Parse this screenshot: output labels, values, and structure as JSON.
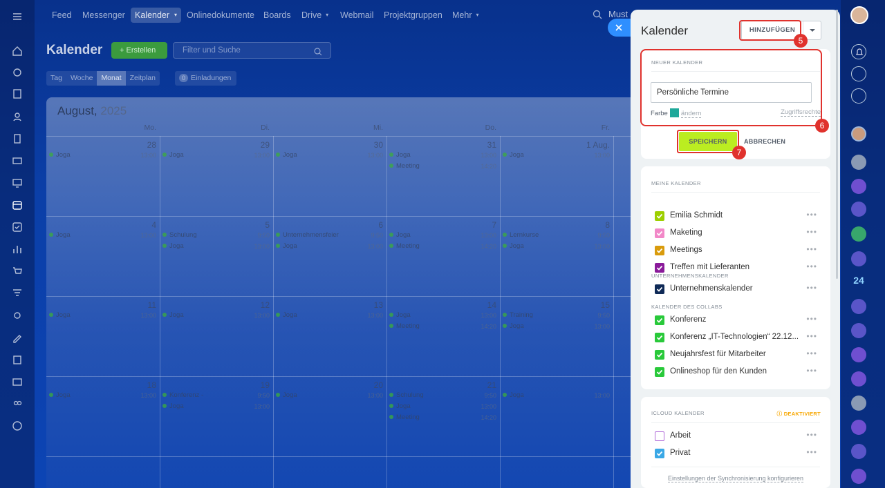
{
  "nav": {
    "items": [
      "Feed",
      "Messenger",
      "Kalender",
      "Onlinedokumente",
      "Boards",
      "Drive",
      "Webmail",
      "Projektgruppen",
      "Mehr"
    ],
    "search_text": "Must"
  },
  "page": {
    "title": "Kalender",
    "create_label": "+ Erstellen",
    "filter_placeholder": "Filter und Suche",
    "views": [
      "Tag",
      "Woche",
      "Monat",
      "Zeitplan"
    ],
    "invites_count": "0",
    "invites_label": "Einladungen"
  },
  "calendar": {
    "month": "August,",
    "year": "2025",
    "weekdays": [
      "Mo.",
      "Di.",
      "Mi.",
      "Do.",
      "Fr."
    ],
    "weeks": [
      {
        "days": [
          "28",
          "29",
          "30",
          "31",
          "1 Aug."
        ]
      },
      {
        "days": [
          "4",
          "5",
          "6",
          "7",
          "8"
        ]
      },
      {
        "days": [
          "11",
          "12",
          "13",
          "14",
          "15"
        ]
      },
      {
        "days": [
          "18",
          "19",
          "20",
          "21",
          ""
        ]
      }
    ],
    "events": [
      {
        "w": 0,
        "d": 0,
        "r": 0,
        "t": "Joga",
        "tm": "13:00"
      },
      {
        "w": 0,
        "d": 1,
        "r": 0,
        "t": "Joga",
        "tm": "13:00"
      },
      {
        "w": 0,
        "d": 2,
        "r": 0,
        "t": "Joga",
        "tm": "13:00"
      },
      {
        "w": 0,
        "d": 3,
        "r": 0,
        "t": "Joga",
        "tm": "13:00"
      },
      {
        "w": 0,
        "d": 3,
        "r": 1,
        "t": "Meeting",
        "tm": "14:20"
      },
      {
        "w": 0,
        "d": 4,
        "r": 0,
        "t": "Joga",
        "tm": "13:00"
      },
      {
        "w": 1,
        "d": 0,
        "r": 0,
        "t": "Joga",
        "tm": "13:00"
      },
      {
        "w": 1,
        "d": 1,
        "r": 0,
        "t": "Schulung",
        "tm": "9:50"
      },
      {
        "w": 1,
        "d": 1,
        "r": 1,
        "t": "Joga",
        "tm": "13:00"
      },
      {
        "w": 1,
        "d": 2,
        "r": 0,
        "t": "Unternehmensfeier",
        "tm": "9:50"
      },
      {
        "w": 1,
        "d": 2,
        "r": 1,
        "t": "Joga",
        "tm": "13:00"
      },
      {
        "w": 1,
        "d": 3,
        "r": 0,
        "t": "Joga",
        "tm": "13:00"
      },
      {
        "w": 1,
        "d": 3,
        "r": 1,
        "t": "Meeting",
        "tm": "14:20"
      },
      {
        "w": 1,
        "d": 4,
        "r": 0,
        "t": "Lernkurse",
        "tm": "9:50"
      },
      {
        "w": 1,
        "d": 4,
        "r": 1,
        "t": "Joga",
        "tm": "13:00"
      },
      {
        "w": 2,
        "d": 0,
        "r": 0,
        "t": "Joga",
        "tm": "13:00"
      },
      {
        "w": 2,
        "d": 1,
        "r": 0,
        "t": "Joga",
        "tm": "13:00"
      },
      {
        "w": 2,
        "d": 2,
        "r": 0,
        "t": "Joga",
        "tm": "13:00"
      },
      {
        "w": 2,
        "d": 3,
        "r": 0,
        "t": "Joga",
        "tm": "13:00"
      },
      {
        "w": 2,
        "d": 3,
        "r": 1,
        "t": "Meeting",
        "tm": "14:20"
      },
      {
        "w": 2,
        "d": 4,
        "r": 0,
        "t": "Training",
        "tm": "9:50"
      },
      {
        "w": 2,
        "d": 4,
        "r": 1,
        "t": "Joga",
        "tm": "13:00"
      },
      {
        "w": 3,
        "d": 0,
        "r": 0,
        "t": "Joga",
        "tm": "13:00"
      },
      {
        "w": 3,
        "d": 1,
        "r": 0,
        "t": "Konferenz -",
        "tm": "9:50"
      },
      {
        "w": 3,
        "d": 1,
        "r": 1,
        "t": "Joga",
        "tm": "13:00"
      },
      {
        "w": 3,
        "d": 2,
        "r": 0,
        "t": "Joga",
        "tm": "13:00"
      },
      {
        "w": 3,
        "d": 3,
        "r": 0,
        "t": "Schulung",
        "tm": "9:50"
      },
      {
        "w": 3,
        "d": 3,
        "r": 1,
        "t": "Joga",
        "tm": "13:00"
      },
      {
        "w": 3,
        "d": 3,
        "r": 2,
        "t": "Meeting",
        "tm": "14:20"
      },
      {
        "w": 3,
        "d": 4,
        "r": 0,
        "t": "Joga",
        "tm": "13:00"
      }
    ]
  },
  "panel": {
    "title": "Kalender",
    "add_label": "HINZUFÜGEN",
    "badge_add": "5",
    "badge_new": "6",
    "badge_save": "7",
    "new_section_title": "NEUER KALENDER",
    "name_value": "Persönliche Termine",
    "color_label": "Farbe",
    "color_hex": "#1ea89a",
    "change_label": "ändern",
    "access_label": "Zugriffsrechte",
    "save_label": "SPEICHERN",
    "cancel_label": "ABBRECHEN",
    "my_section_title": "MEINE KALENDER",
    "my_calendars": [
      {
        "name": "Emilia Schmidt",
        "color": "#9dcf00"
      },
      {
        "name": "Maketing",
        "color": "#f288c8"
      },
      {
        "name": "Meetings",
        "color": "#d99b0c"
      },
      {
        "name": "Treffen mit Lieferanten",
        "color": "#8a1a9a"
      }
    ],
    "company_section_title": "UNTERNEHMENSKALENDER",
    "company_calendars": [
      {
        "name": "Unternehmenskalender",
        "color": "#0f2a57"
      }
    ],
    "collab_section_title": "KALENDER DES COLLABS",
    "collab_calendars": [
      {
        "name": "Konferenz",
        "color": "#29c93a"
      },
      {
        "name": "Konferenz „IT-Technologien“ 22.12...",
        "color": "#29c93a"
      },
      {
        "name": "Neujahrsfest für Mitarbeiter",
        "color": "#29c93a"
      },
      {
        "name": "Onlineshop für den Kunden",
        "color": "#29c93a"
      }
    ],
    "icloud_section_title": "ICLOUD KALENDER",
    "icloud_status": "DEAKTIVIERT",
    "icloud_calendars": [
      {
        "name": "Arbeit",
        "color": "#b06ad8",
        "checked": false
      },
      {
        "name": "Privat",
        "color": "#3aa8e6",
        "checked": true
      }
    ],
    "sync_label": "Einstellungen der Synchronisierung konfigurieren"
  },
  "rightbar": {
    "badge_number": "24"
  }
}
